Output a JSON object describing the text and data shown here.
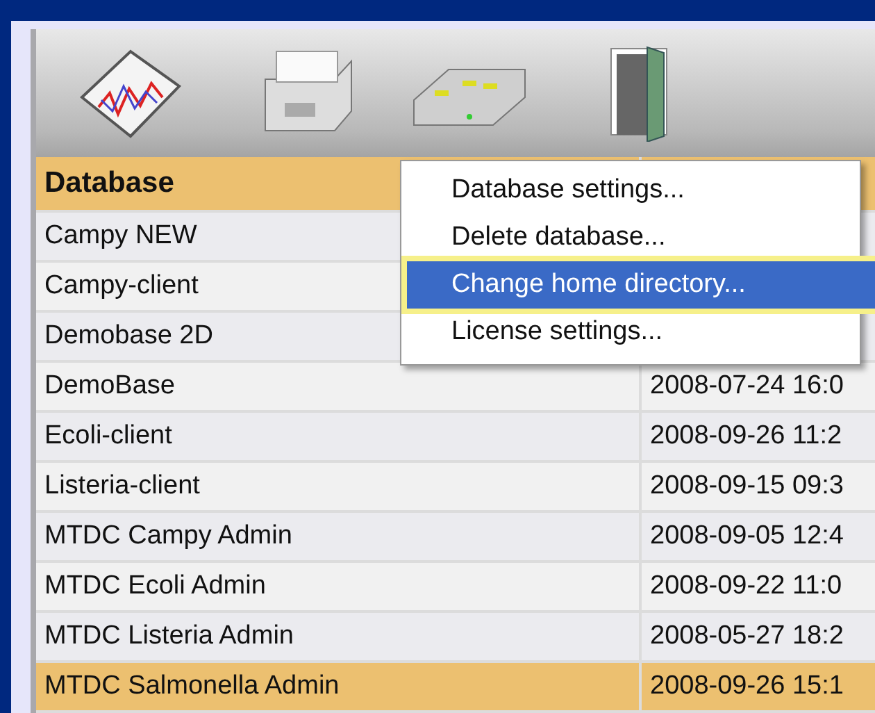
{
  "toolbar": {
    "buttons": [
      {
        "kind": "chart"
      },
      {
        "kind": "drawer"
      },
      {
        "kind": "switch"
      },
      {
        "kind": "door"
      }
    ]
  },
  "table": {
    "columns": [
      "Database"
    ],
    "rows": [
      {
        "name": "Campy NEW",
        "selected": false
      },
      {
        "name": "Campy-client",
        "selected": false
      },
      {
        "name": "Demobase 2D",
        "selected": false
      },
      {
        "name": "DemoBase",
        "date": "2008-07-24 16:0",
        "selected": false
      },
      {
        "name": "Ecoli-client",
        "date": "2008-09-26 11:2",
        "selected": false
      },
      {
        "name": "Listeria-client",
        "date": "2008-09-15 09:3",
        "selected": false
      },
      {
        "name": "MTDC Campy Admin",
        "date": "2008-09-05 12:4",
        "selected": false
      },
      {
        "name": "MTDC Ecoli Admin",
        "date": "2008-09-22 11:0",
        "selected": false
      },
      {
        "name": "MTDC Listeria Admin",
        "date": "2008-05-27 18:2",
        "selected": false
      },
      {
        "name": "MTDC Salmonella Admin",
        "date": "2008-09-26 15:1",
        "selected": true
      }
    ]
  },
  "context_menu": {
    "items": [
      {
        "label": "Database settings...",
        "selected": false
      },
      {
        "label": "Delete database...",
        "selected": false
      },
      {
        "label": "Change home directory...",
        "selected": true
      },
      {
        "label": "License settings...",
        "selected": false
      }
    ]
  }
}
